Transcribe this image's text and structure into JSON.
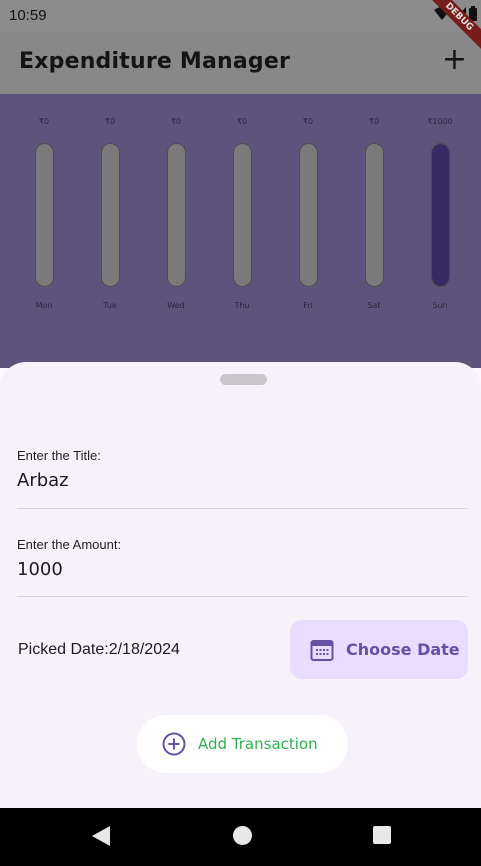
{
  "status_bar": {
    "time": "10:59"
  },
  "debug_banner": {
    "label": "DEBUG"
  },
  "app_bar": {
    "title": "Expenditure Manager",
    "add_icon": "+"
  },
  "chart_data": {
    "type": "bar",
    "categories": [
      "Mon",
      "Tue",
      "Wed",
      "Thu",
      "Fri",
      "Sat",
      "Sun"
    ],
    "value_labels": [
      "₹0",
      "₹0",
      "₹0",
      "₹0",
      "₹0",
      "₹0",
      "₹1000"
    ],
    "values": [
      0,
      0,
      0,
      0,
      0,
      0,
      1000
    ],
    "ylim": [
      0,
      1000
    ],
    "colors": {
      "fill": "#372a63",
      "track": "#7a7a7a"
    }
  },
  "sheet": {
    "title_field": {
      "label": "Enter the Title:",
      "value": "Arbaz"
    },
    "amount_field": {
      "label": "Enter the Amount:",
      "value": "1000"
    },
    "picked_date": "Picked Date:2/18/2024",
    "choose_date_button": {
      "label": "Choose Date",
      "icon": "calendar-icon"
    },
    "add_transaction_button": {
      "label": "Add Transaction",
      "icon": "add-circle-icon"
    }
  },
  "colors": {
    "accent": "#6750a4",
    "success": "#2db04f",
    "sheet_bg": "#f7f2fa"
  }
}
